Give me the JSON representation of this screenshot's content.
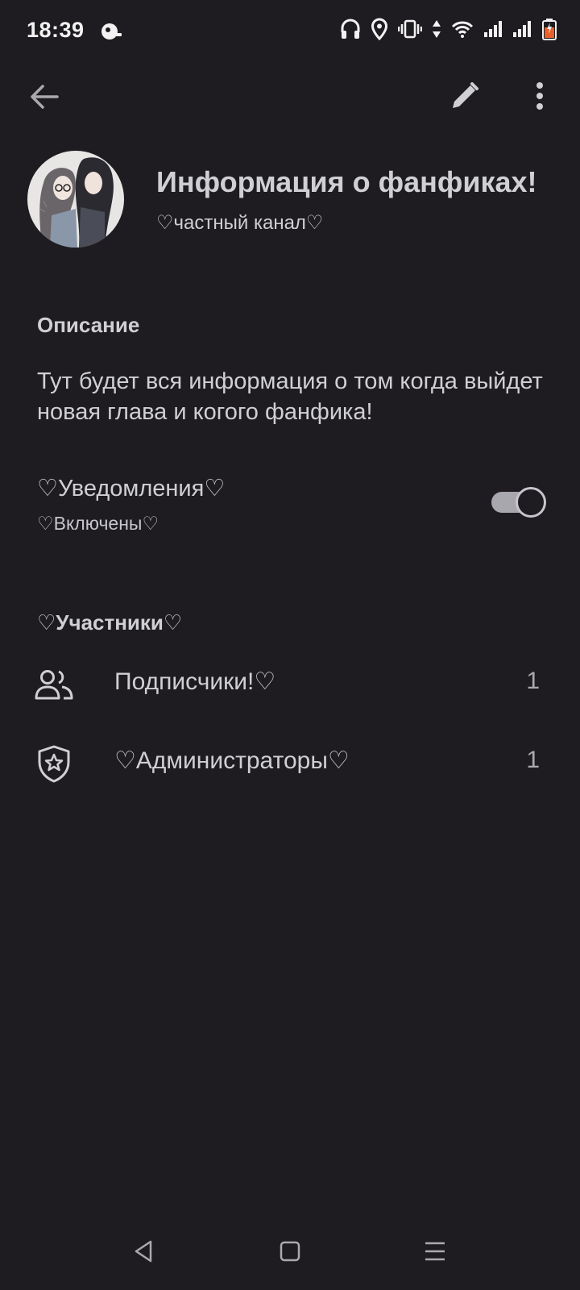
{
  "status_bar": {
    "time": "18:39",
    "icons": [
      "headphones-icon",
      "location-icon",
      "vibrate-icon",
      "data-arrows-icon",
      "wifi-icon",
      "signal-icon",
      "signal-icon",
      "battery-charging-icon"
    ]
  },
  "app_bar": {
    "back_icon": "arrow-back-icon",
    "edit_icon": "pencil-icon",
    "more_icon": "more-vert-icon"
  },
  "channel": {
    "title": "Информация о фанфиках!",
    "subtitle": "♡частный канал♡"
  },
  "description": {
    "heading": "Описание",
    "text": "Тут будет вся информация о том когда выйдет новая глава и когого фанфика!"
  },
  "notifications": {
    "title": "♡Уведомления♡",
    "status": "♡Включены♡",
    "enabled": true
  },
  "members": {
    "heading": "♡Участники♡",
    "rows": [
      {
        "label": "Подписчики!♡",
        "count": "1",
        "icon": "people-icon"
      },
      {
        "label": "♡Администраторы♡",
        "count": "1",
        "icon": "shield-star-icon"
      }
    ]
  },
  "colors": {
    "background": "#1e1c20",
    "text": "#cfcfd4",
    "toggle_track": "#a7a7ad"
  },
  "nav_bar": {
    "icons": [
      "nav-back-icon",
      "nav-home-icon",
      "nav-recents-icon"
    ]
  }
}
